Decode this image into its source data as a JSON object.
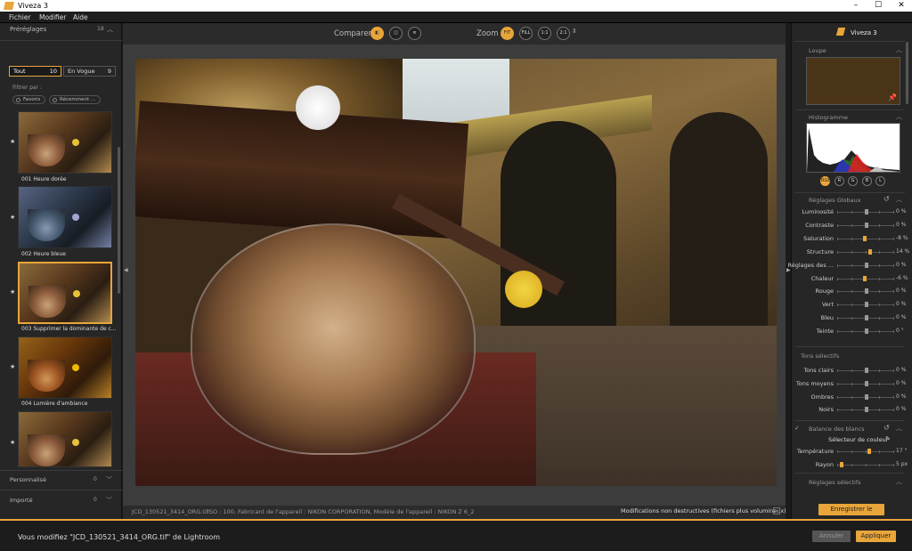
{
  "window": {
    "title": "Viveza 3",
    "controls": {
      "minimize": "–",
      "maximize": "☐",
      "close": "✕"
    }
  },
  "menu": [
    "Fichier",
    "Modifier",
    "Aide"
  ],
  "left": {
    "header": "Préréglages",
    "count": "18",
    "tabs": [
      {
        "label": "Tout",
        "count": "10"
      },
      {
        "label": "En Vogue",
        "count": "9"
      }
    ],
    "filter_label": "Filtrer par :",
    "chips": [
      "Favoris",
      "Récemment ..."
    ],
    "presets": [
      {
        "label": "001 Heure dorée"
      },
      {
        "label": "002 Heure bleue"
      },
      {
        "label": "003 Supprimer la dominante de c..."
      },
      {
        "label": "004 Lumière d'ambiance"
      },
      {
        "label": ""
      }
    ],
    "sections": [
      {
        "label": "Personnalisé",
        "count": "0"
      },
      {
        "label": "Importé",
        "count": "0"
      }
    ]
  },
  "toolbar": {
    "compare_label": "Comparer",
    "zoom_label": "Zoom",
    "zoom_buttons": [
      "FIT",
      "FILL",
      "1:1",
      "2:1"
    ]
  },
  "status": {
    "filename": "JCD_130521_3414_ORG.tif",
    "exif": "ISO : 100, Fabricant de l'appareil : NIKON CORPORATION, Modèle de l'appareil : NIKON Z 6_2",
    "nondestructive": "Modifications non destructives (fichiers plus volumineux)"
  },
  "right": {
    "title": "Viveza 3",
    "loupe": "Loupe",
    "histogram": "Histogramme",
    "channels": [
      "RGB",
      "R",
      "G",
      "B",
      "L"
    ],
    "global_title": "Réglages Globaux",
    "global": [
      {
        "label": "Luminosité",
        "value": "0 %",
        "pos": 0.5
      },
      {
        "label": "Contraste",
        "value": "0 %",
        "pos": 0.5
      },
      {
        "label": "Saturation",
        "value": "-8 %",
        "pos": 0.46
      },
      {
        "label": "Structure",
        "value": "14 %",
        "pos": 0.57
      },
      {
        "label": "Réglages des ...",
        "value": "0 %",
        "pos": 0.5
      },
      {
        "label": "Chaleur",
        "value": "-6 %",
        "pos": 0.47
      },
      {
        "label": "Rouge",
        "value": "0 %",
        "pos": 0.5
      },
      {
        "label": "Vert",
        "value": "0 %",
        "pos": 0.5
      },
      {
        "label": "Bleu",
        "value": "0 %",
        "pos": 0.5
      },
      {
        "label": "Teinte",
        "value": "0 °",
        "pos": 0.5
      }
    ],
    "tones_title": "Tons sélectifs",
    "tones": [
      {
        "label": "Tons clairs",
        "value": "0 %",
        "pos": 0.5
      },
      {
        "label": "Tons moyens",
        "value": "0 %",
        "pos": 0.5
      },
      {
        "label": "Ombres",
        "value": "0 %",
        "pos": 0.5
      },
      {
        "label": "Noirs",
        "value": "0 %",
        "pos": 0.5
      }
    ],
    "wb_title": "Balance des blancs",
    "wb_picker": "Sélecteur de couleur",
    "wb": [
      {
        "label": "Température",
        "value": "17 °",
        "pos": 0.55
      },
      {
        "label": "Rayon",
        "value": "5 px",
        "pos": 0.05
      }
    ],
    "selective_title": "Réglages sélectifs",
    "save_preset": "Enregistrer le préréglage"
  },
  "bottom": {
    "message": "Vous modifiez \"JCD_130521_3414_ORG.tif\" de Lightroom",
    "cancel": "Annuler",
    "apply": "Appliquer"
  },
  "colors": {
    "accent": "#e8a53a",
    "panel": "#262626",
    "background": "#3c3c3c"
  }
}
